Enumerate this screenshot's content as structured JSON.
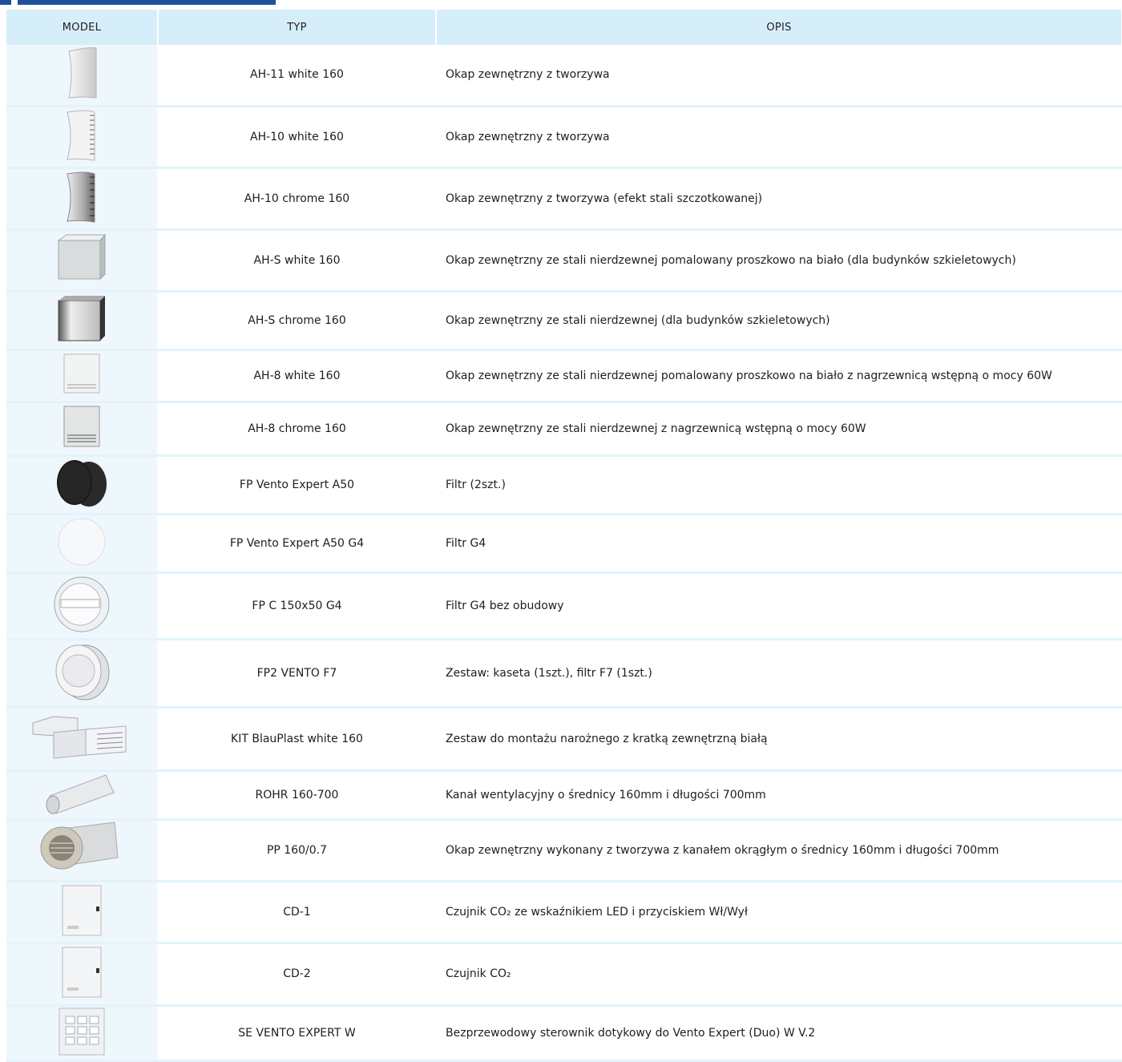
{
  "header": {
    "model": "MODEL",
    "typ": "TYP",
    "opis": "OPIS"
  },
  "rows": [
    {
      "typ": "AH-11 white 160",
      "opis": "Okap zewnętrzny z tworzywa",
      "icon": "hood-white-icon"
    },
    {
      "typ": "AH-10 white 160",
      "opis": "Okap zewnętrzny z tworzywa",
      "icon": "hood-louvred-white-icon"
    },
    {
      "typ": "AH-10 chrome 160",
      "opis": "Okap zewnętrzny z tworzywa (efekt stali szczotkowanej)",
      "icon": "hood-chrome-icon"
    },
    {
      "typ": "AH-S white 160",
      "opis": "Okap zewnętrzny ze stali nierdzewnej pomalowany proszkowo na biało (dla budynków szkieletowych)",
      "icon": "steel-box-hood-white-icon"
    },
    {
      "typ": "AH-S chrome 160",
      "opis": "Okap zewnętrzny ze stali nierdzewnej  (dla budynków szkieletowych)",
      "icon": "steel-box-hood-chrome-icon"
    },
    {
      "typ": "AH-8 white 160",
      "opis": "Okap zewnętrzny ze stali nierdzewnej pomalowany proszkowo na biało z nagrzewnicą wstępną o mocy 60W",
      "icon": "heated-hood-white-icon"
    },
    {
      "typ": "AH-8 chrome 160",
      "opis": "Okap zewnętrzny ze stali nierdzewnej  z nagrzewnicą wstępną o mocy 60W",
      "icon": "heated-hood-chrome-icon"
    },
    {
      "typ": "FP Vento Expert A50",
      "opis": "Filtr (2szt.)",
      "icon": "black-filter-pads-icon"
    },
    {
      "typ": "FP Vento Expert A50 G4",
      "opis": "Filtr G4",
      "icon": "white-filter-disc-icon"
    },
    {
      "typ": "FP C 150x50 G4",
      "opis": "Filtr G4 bez obudowy",
      "icon": "round-filter-icon"
    },
    {
      "typ": "FP2 VENTO F7",
      "opis": "Zestaw: kaseta (1szt.), filtr F7 (1szt.)",
      "icon": "filter-cassette-icon"
    },
    {
      "typ": "KIT BlauPlast white 160",
      "opis": "Zestaw do montażu narożnego z kratką zewnętrzną białą",
      "icon": "corner-kit-icon"
    },
    {
      "typ": "ROHR 160-700",
      "opis": "Kanał wentylacyjny o średnicy 160mm i długości 700mm",
      "icon": "duct-pipe-icon"
    },
    {
      "typ": "PP 160/0.7",
      "opis": "Okap zewnętrzny wykonany z tworzywa z kanałem okrągłym o średnicy 160mm i długości 700mm",
      "icon": "hood-with-duct-icon"
    },
    {
      "typ": "CD-1",
      "opis": "Czujnik CO₂ ze wskaźnikiem LED i przyciskiem Wł/Wył",
      "icon": "co2-sensor-icon"
    },
    {
      "typ": "CD-2",
      "opis": "Czujnik CO₂",
      "icon": "co2-sensor-icon"
    },
    {
      "typ": "SE VENTO EXPERT W",
      "opis": "Bezprzewodowy sterownik dotykowy do Vento Expert (Duo) W V.2",
      "icon": "touch-controller-icon"
    }
  ]
}
